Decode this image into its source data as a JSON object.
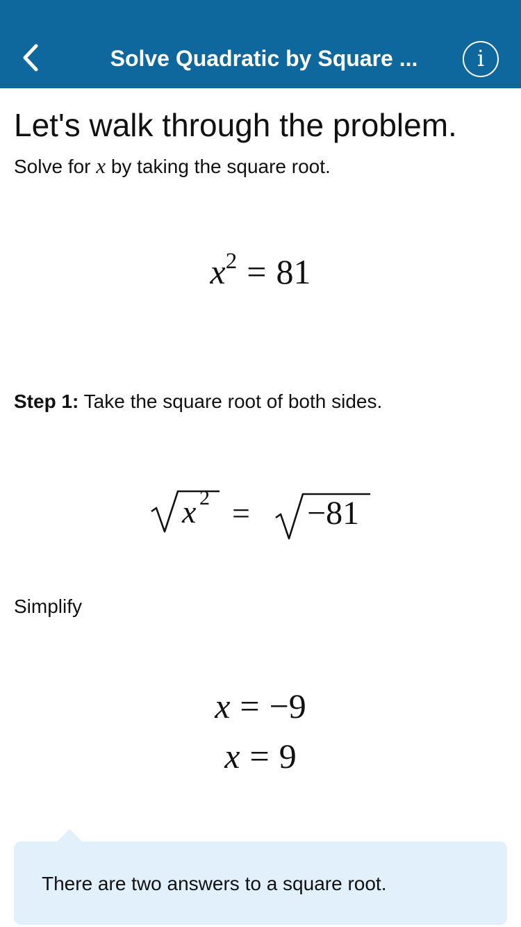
{
  "nav": {
    "title": "Solve Quadratic by Square ...",
    "back_icon": "chevron-left-icon",
    "info_icon": "info-icon",
    "info_glyph": "i",
    "bar_color": "#0f689d"
  },
  "content": {
    "heading": "Let's walk through the problem.",
    "instruction_before": "Solve for",
    "instruction_var": "x",
    "instruction_after": "by taking the square root.",
    "equation": {
      "var": "x",
      "exponent": "2",
      "equals": "=",
      "rhs": "81"
    },
    "step1": {
      "label": "Step 1:",
      "text": "Take the square root of both sides."
    },
    "sqrt_equation": {
      "lhs_var": "x",
      "lhs_exp": "2",
      "equals": "=",
      "rhs": "−81"
    },
    "simplify_label": "Simplify",
    "solutions": [
      {
        "var": "x",
        "equals": "=",
        "value": "−9"
      },
      {
        "var": "x",
        "equals": "=",
        "value": "9"
      }
    ],
    "note": "There are two answers to a square root.",
    "note_color": "#e2f0fb"
  }
}
